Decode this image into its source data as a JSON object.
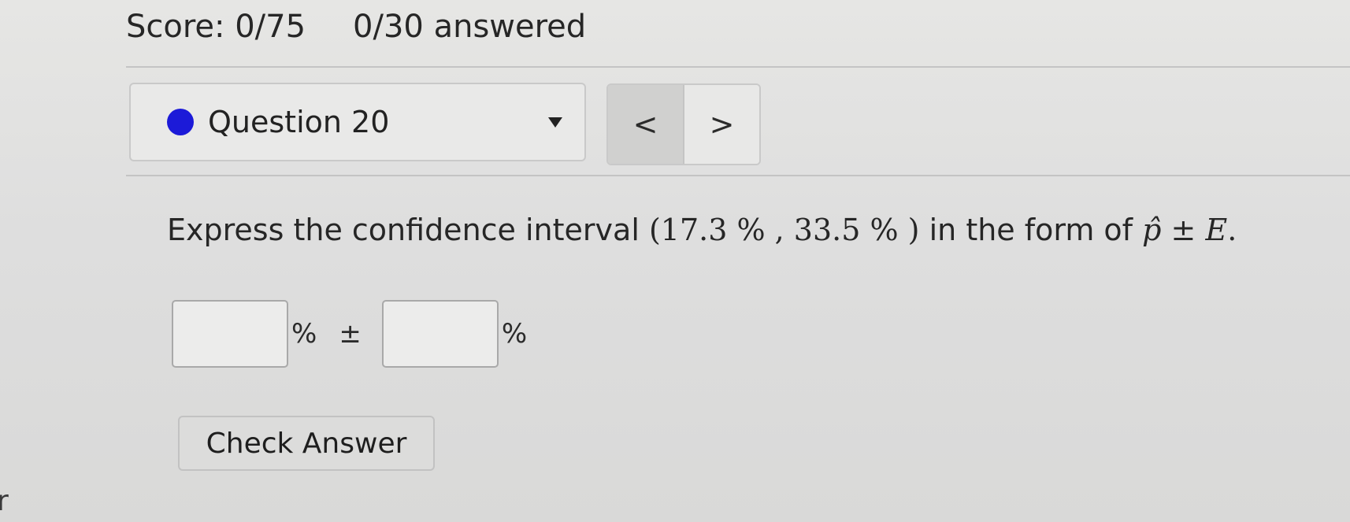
{
  "header": {
    "score": "Score: 0/75",
    "answered": "0/30 answered"
  },
  "question_nav": {
    "status_color": "#1c1ad8",
    "label": "Question 20",
    "dropdown_icon": "caret-down-icon",
    "prev_symbol": "<",
    "next_symbol": ">"
  },
  "question": {
    "prefix": "Express the confidence interval ",
    "interval": "(17.3 % , 33.5 % )",
    "middle": " in the form of ",
    "phat": "p̂",
    "pm": " ± ",
    "e": "E",
    "period": "."
  },
  "answer": {
    "phat_value": "",
    "percent1": "%",
    "pm": "±",
    "margin_value": "",
    "percent2": "%"
  },
  "check_button": "Check Answer",
  "edge_text": "r"
}
